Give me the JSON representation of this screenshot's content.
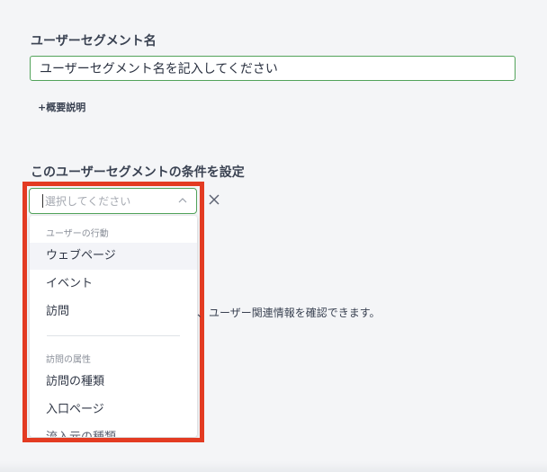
{
  "segment_name": {
    "label": "ユーザーセグメント名",
    "value": "ユーザーセグメント名を記入してください"
  },
  "description_link": "+概要説明",
  "condition": {
    "label": "このユーザーセグメントの条件を設定",
    "select_placeholder": "選択してください",
    "info_text": "ユーザー関連情報を確認できます。",
    "dropdown": {
      "group1_header": "ユーザーの行動",
      "group1_options": [
        "ウェブページ",
        "イベント",
        "訪問"
      ],
      "group2_header": "訪問の属性",
      "group2_options": [
        "訪問の種類",
        "入口ページ",
        "流入元の種類"
      ]
    }
  },
  "colors": {
    "accent_green": "#52a35a",
    "highlight_red": "#e33b22",
    "background": "#f4f5f7"
  },
  "icons": {
    "select_chevron": "chevron-up-icon",
    "clear": "close-icon"
  }
}
